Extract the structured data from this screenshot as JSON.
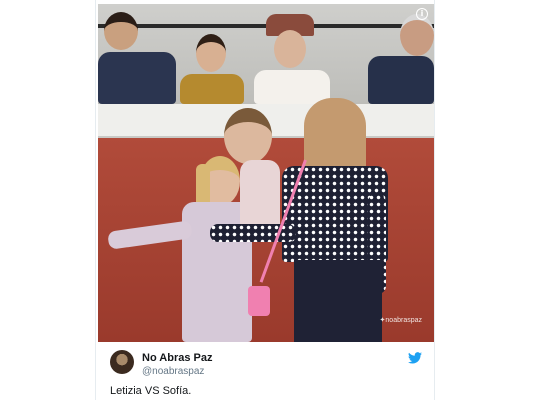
{
  "tweet": {
    "author_name": "No Abras Paz",
    "author_handle": "@noabraspaz",
    "text": "Letizia VS Sofía.",
    "watermark": "✦noabraspaz",
    "info_icon": "info-icon",
    "brand_icon": "twitter-bird-icon",
    "brand_color": "#1da1f2"
  }
}
